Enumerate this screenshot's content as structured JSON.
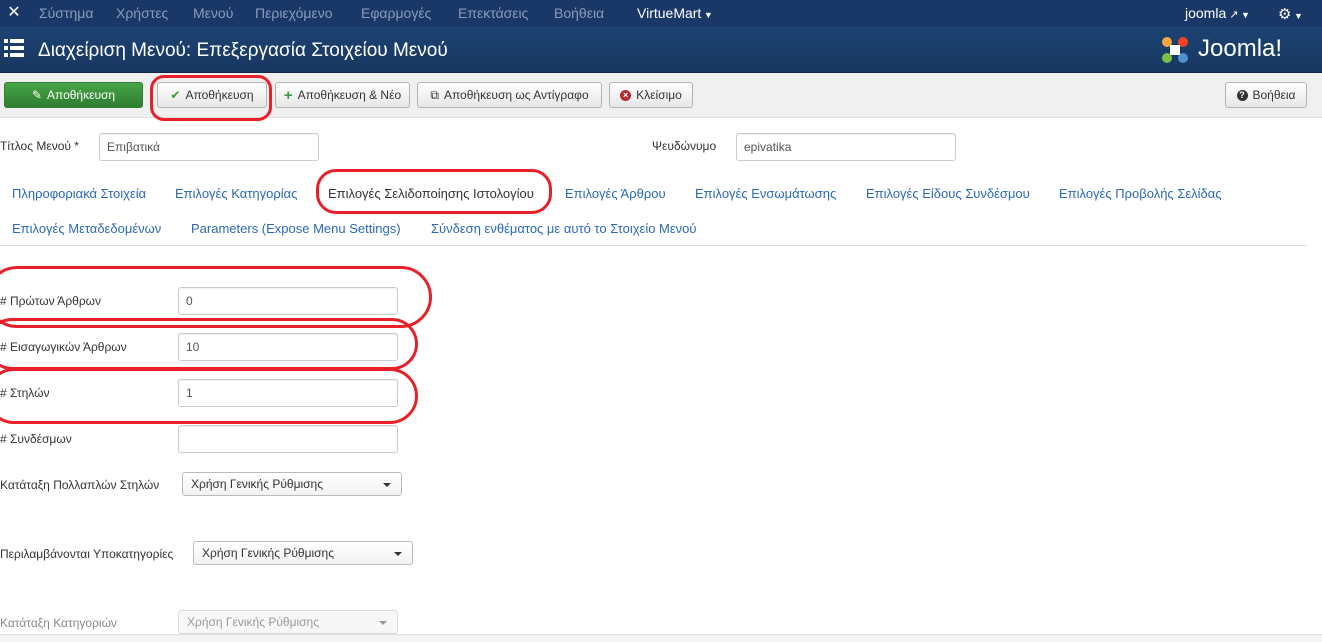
{
  "topbar": {
    "logo_icon": "joomla-logo-icon",
    "menu": [
      "Σύστημα",
      "Χρήστες",
      "Μενού",
      "Περιεχόμενο",
      "Εφαρμογές",
      "Επεκτάσεις",
      "Βοήθεια"
    ],
    "virtuemart": "VirtueMart",
    "user": "joomla",
    "settings_icon": "gear-icon"
  },
  "header": {
    "title": "Διαχείριση Μενού: Επεξεργασία Στοιχείου Μενού",
    "brand": "Joomla!"
  },
  "toolbar": {
    "save_primary": "Αποθήκευση",
    "save": "Αποθήκευση",
    "save_new": "Αποθήκευση & Νέο",
    "save_copy": "Αποθήκευση ως Αντίγραφο",
    "close": "Κλείσιμο",
    "help": "Βοήθεια"
  },
  "form": {
    "title_label": "Τίτλος Μενού *",
    "title_value": "Επιβατικά",
    "alias_label": "Ψευδώνυμο",
    "alias_value": "epivatika"
  },
  "tabs": [
    "Πληροφοριακά Στοιχεία",
    "Επιλογές Κατηγορίας",
    "Επιλογές Σελιδοποίησης Ιστολογίου",
    "Επιλογές Άρθρου",
    "Επιλογές Ενσωμάτωσης",
    "Επιλογές Είδους Συνδέσμου",
    "Επιλογές Προβολής Σελίδας",
    "Επιλογές Μεταδεδομένων",
    "Parameters (Expose Menu Settings)",
    "Σύνδεση ενθέματος με αυτό το Στοιχείο Μενού"
  ],
  "blog": {
    "leading_label": "# Πρώτων Άρθρων",
    "leading_value": "0",
    "intro_label": "# Εισαγωγικών Άρθρων",
    "intro_value": "10",
    "columns_label": "# Στηλών",
    "columns_value": "1",
    "links_label": "# Συνδέσμων",
    "links_value": "",
    "multi_order_label": "Κατάταξη Πολλαπλών Στηλών",
    "multi_order_value": "Χρήση Γενικής Ρύθμισης",
    "subcats_label": "Περιλαμβάνονται Υποκατηγορίες",
    "subcats_value": "Χρήση Γενικής Ρύθμισης",
    "cat_order_label": "Κατάταξη Κατηγοριών",
    "cat_order_value": "Χρήση Γενικής Ρύθμισης"
  }
}
